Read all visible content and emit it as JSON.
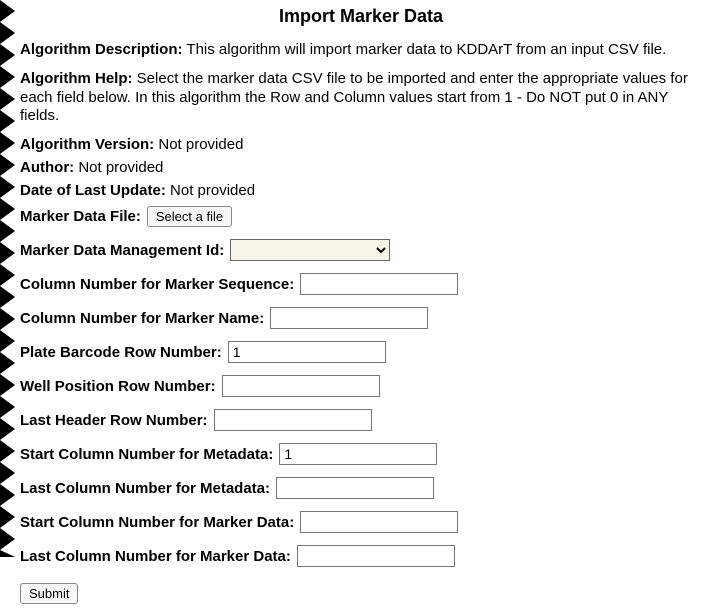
{
  "title": "Import Marker Data",
  "desc_label": "Algorithm Description:",
  "desc_text": "This algorithm will import marker data to KDDArT from an input CSV file.",
  "help_label": "Algorithm Help:",
  "help_text": "Select the marker data CSV file to be imported and enter the appropriate values for each field below. In this algorithm the Row and Column values start from 1 - Do NOT put 0 in ANY fields.",
  "version_label": "Algorithm Version:",
  "version_text": "Not provided",
  "author_label": "Author:",
  "author_text": "Not provided",
  "date_label": "Date of Last Update:",
  "date_text": "Not provided",
  "file_label": "Marker Data File:",
  "file_button": "Select a file",
  "mgmt_label": "Marker Data Management Id:",
  "fields": {
    "seq": {
      "label": "Column Number for Marker Sequence:",
      "value": ""
    },
    "name": {
      "label": "Column Number for Marker Name:",
      "value": ""
    },
    "plate": {
      "label": "Plate Barcode Row Number:",
      "value": "1"
    },
    "well": {
      "label": "Well Position Row Number:",
      "value": ""
    },
    "lhdr": {
      "label": "Last Header Row Number:",
      "value": ""
    },
    "smeta": {
      "label": "Start Column Number for Metadata:",
      "value": "1"
    },
    "lmeta": {
      "label": "Last Column Number for Metadata:",
      "value": ""
    },
    "sdata": {
      "label": "Start Column Number for Marker Data:",
      "value": ""
    },
    "ldata": {
      "label": "Last Column Number for Marker Data:",
      "value": ""
    }
  },
  "submit_label": "Submit"
}
